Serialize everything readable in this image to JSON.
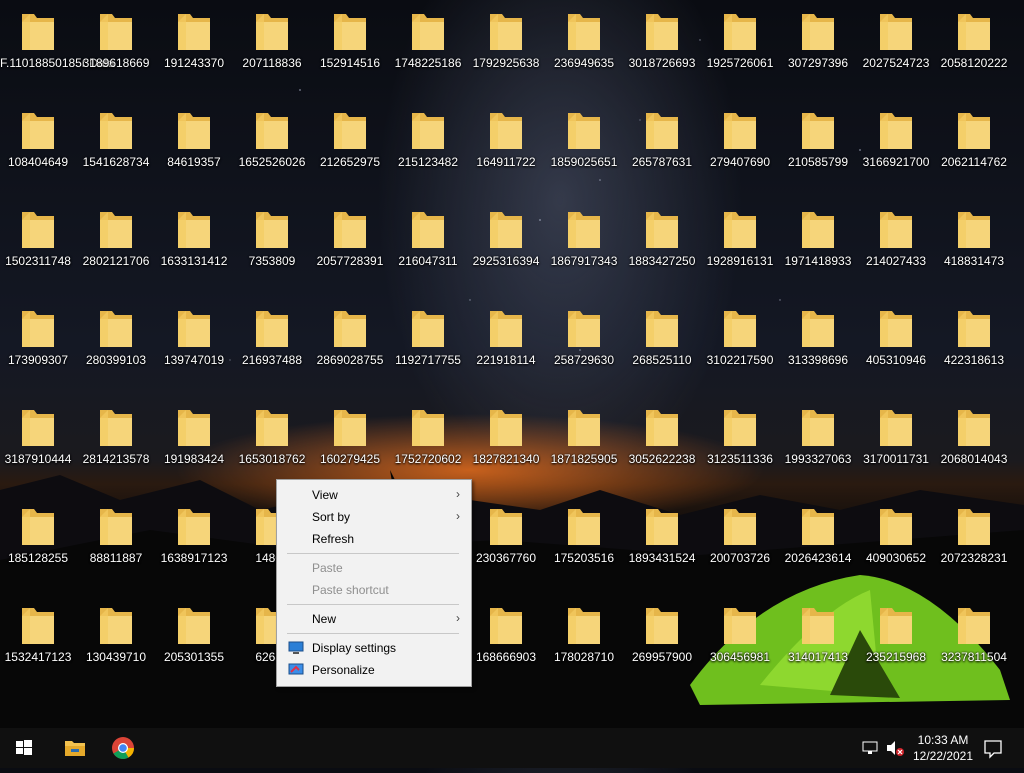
{
  "desktop": {
    "icons": [
      [
        "F.11018850185r Data",
        "3189618669",
        "191243370",
        "207118836",
        "152914516",
        "1748225186",
        "1792925638",
        "236949635",
        "3018726693",
        "1925726061",
        "307297396",
        "2027524723",
        "2058120222"
      ],
      [
        "108404649",
        "1541628734",
        "84619357",
        "1652526026",
        "212652975",
        "215123482",
        "164911722",
        "1859025651",
        "265787631",
        "279407690",
        "210585799",
        "3166921700",
        "2062114762"
      ],
      [
        "1502311748",
        "2802121706",
        "1633131412",
        "7353809",
        "2057728391",
        "216047311",
        "2925316394",
        "1867917343",
        "1883427250",
        "1928916131",
        "1971418933",
        "214027433",
        "418831473"
      ],
      [
        "173909307",
        "280399103",
        "139747019",
        "216937488",
        "2869028755",
        "1192717755",
        "221918114",
        "258729630",
        "268525110",
        "3102217590",
        "313398696",
        "405310946",
        "422318613"
      ],
      [
        "3187910444",
        "2814213578",
        "191983424",
        "1653018762",
        "160279425",
        "1752720602",
        "1827821340",
        "1871825905",
        "3052622238",
        "3123511336",
        "1993327063",
        "3170011731",
        "2068014043"
      ],
      [
        "185128255",
        "88811887",
        "1638917123",
        "14807",
        "",
        "",
        "230367760",
        "175203516",
        "1893431524",
        "200703726",
        "2026423614",
        "409030652",
        "2072328231"
      ],
      [
        "1532417123",
        "130439710",
        "205301355",
        "62632",
        "",
        "",
        "168666903",
        "178028710",
        "269957900",
        "306456981",
        "314017413",
        "235215968",
        "3237811504"
      ]
    ]
  },
  "context_menu": {
    "items": [
      {
        "label": "View",
        "arrow": "›"
      },
      {
        "label": "Sort by",
        "arrow": "›"
      },
      {
        "label": "Refresh"
      },
      {
        "label": "Paste"
      },
      {
        "label": "Paste shortcut"
      },
      {
        "label": "New",
        "arrow": "›"
      },
      {
        "label": "Display settings"
      },
      {
        "label": "Personalize"
      }
    ]
  },
  "taskbar": {
    "time": "10:33 AM",
    "date": "12/22/2021",
    "icons": [
      "windows-start-icon",
      "file-explorer-icon",
      "chrome-icon",
      "network-icon",
      "volume-muted-icon",
      "notification-icon"
    ]
  }
}
